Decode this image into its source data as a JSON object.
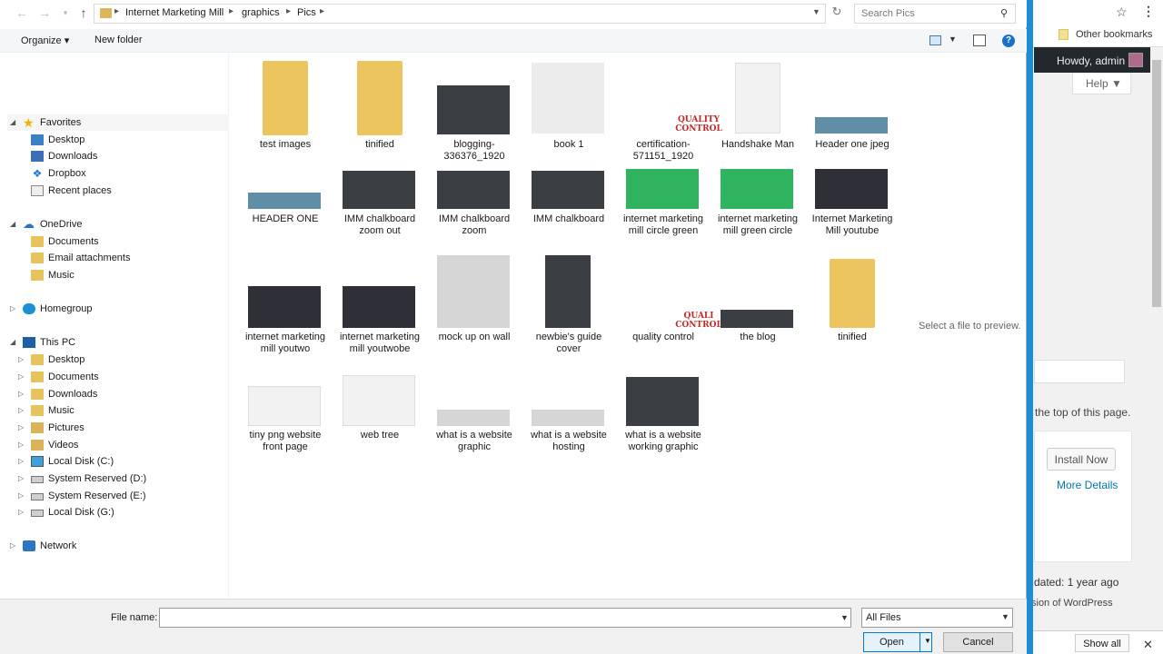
{
  "dialog": {
    "breadcrumb": [
      "Internet Marketing Mill",
      "graphics",
      "Pics"
    ],
    "search_placeholder": "Search Pics",
    "toolbar": {
      "organize": "Organize",
      "new_folder": "New folder"
    },
    "nav": {
      "favorites": "Favorites",
      "favorites_items": [
        "Desktop",
        "Downloads",
        "Dropbox",
        "Recent places"
      ],
      "onedrive": "OneDrive",
      "onedrive_items": [
        "Documents",
        "Email attachments",
        "Music"
      ],
      "homegroup": "Homegroup",
      "thispc": "This PC",
      "thispc_items": [
        "Desktop",
        "Documents",
        "Downloads",
        "Music",
        "Pictures",
        "Videos",
        "Local Disk (C:)",
        "System Reserved (D:)",
        "System Reserved (E:)",
        "Local Disk (G:)"
      ],
      "network": "Network"
    },
    "files": [
      {
        "name": "test images"
      },
      {
        "name": "tinified"
      },
      {
        "name": "blogging-336376_1920"
      },
      {
        "name": "book 1"
      },
      {
        "name": "certification-571151_1920"
      },
      {
        "name": "Handshake Man"
      },
      {
        "name": "Header one jpeg"
      },
      {
        "name": "HEADER ONE"
      },
      {
        "name": "IMM chalkboard zoom out"
      },
      {
        "name": "IMM chalkboard zoom"
      },
      {
        "name": "IMM chalkboard"
      },
      {
        "name": "internet marketing mill circle green"
      },
      {
        "name": "internet marketing mill green circle"
      },
      {
        "name": "Internet Marketing Mill youtube"
      },
      {
        "name": "internet marketing mill youtwo"
      },
      {
        "name": "internet marketing mill youtwobe"
      },
      {
        "name": "mock up on wall"
      },
      {
        "name": "newbie's guide cover"
      },
      {
        "name": "quality control"
      },
      {
        "name": "the blog"
      },
      {
        "name": "tinified"
      },
      {
        "name": "tiny png website front page"
      },
      {
        "name": "web tree"
      },
      {
        "name": "what is a website graphic"
      },
      {
        "name": "what is a website hosting"
      },
      {
        "name": "what is a website working graphic"
      }
    ],
    "preview_text": "Select a file to preview.",
    "file_name_label": "File name:",
    "file_name_value": "",
    "file_type": "All Files",
    "open_label": "Open",
    "cancel_label": "Cancel"
  },
  "browser": {
    "other_bookmarks": "Other bookmarks",
    "howdy": "Howdy, admin",
    "help": "Help ▼",
    "top_text": "the top of this page.",
    "install_now": "Install Now",
    "more_details": "More Details",
    "updated": "dated: 1 year ago",
    "wp_version": "sion of WordPress",
    "show_all": "Show all"
  }
}
